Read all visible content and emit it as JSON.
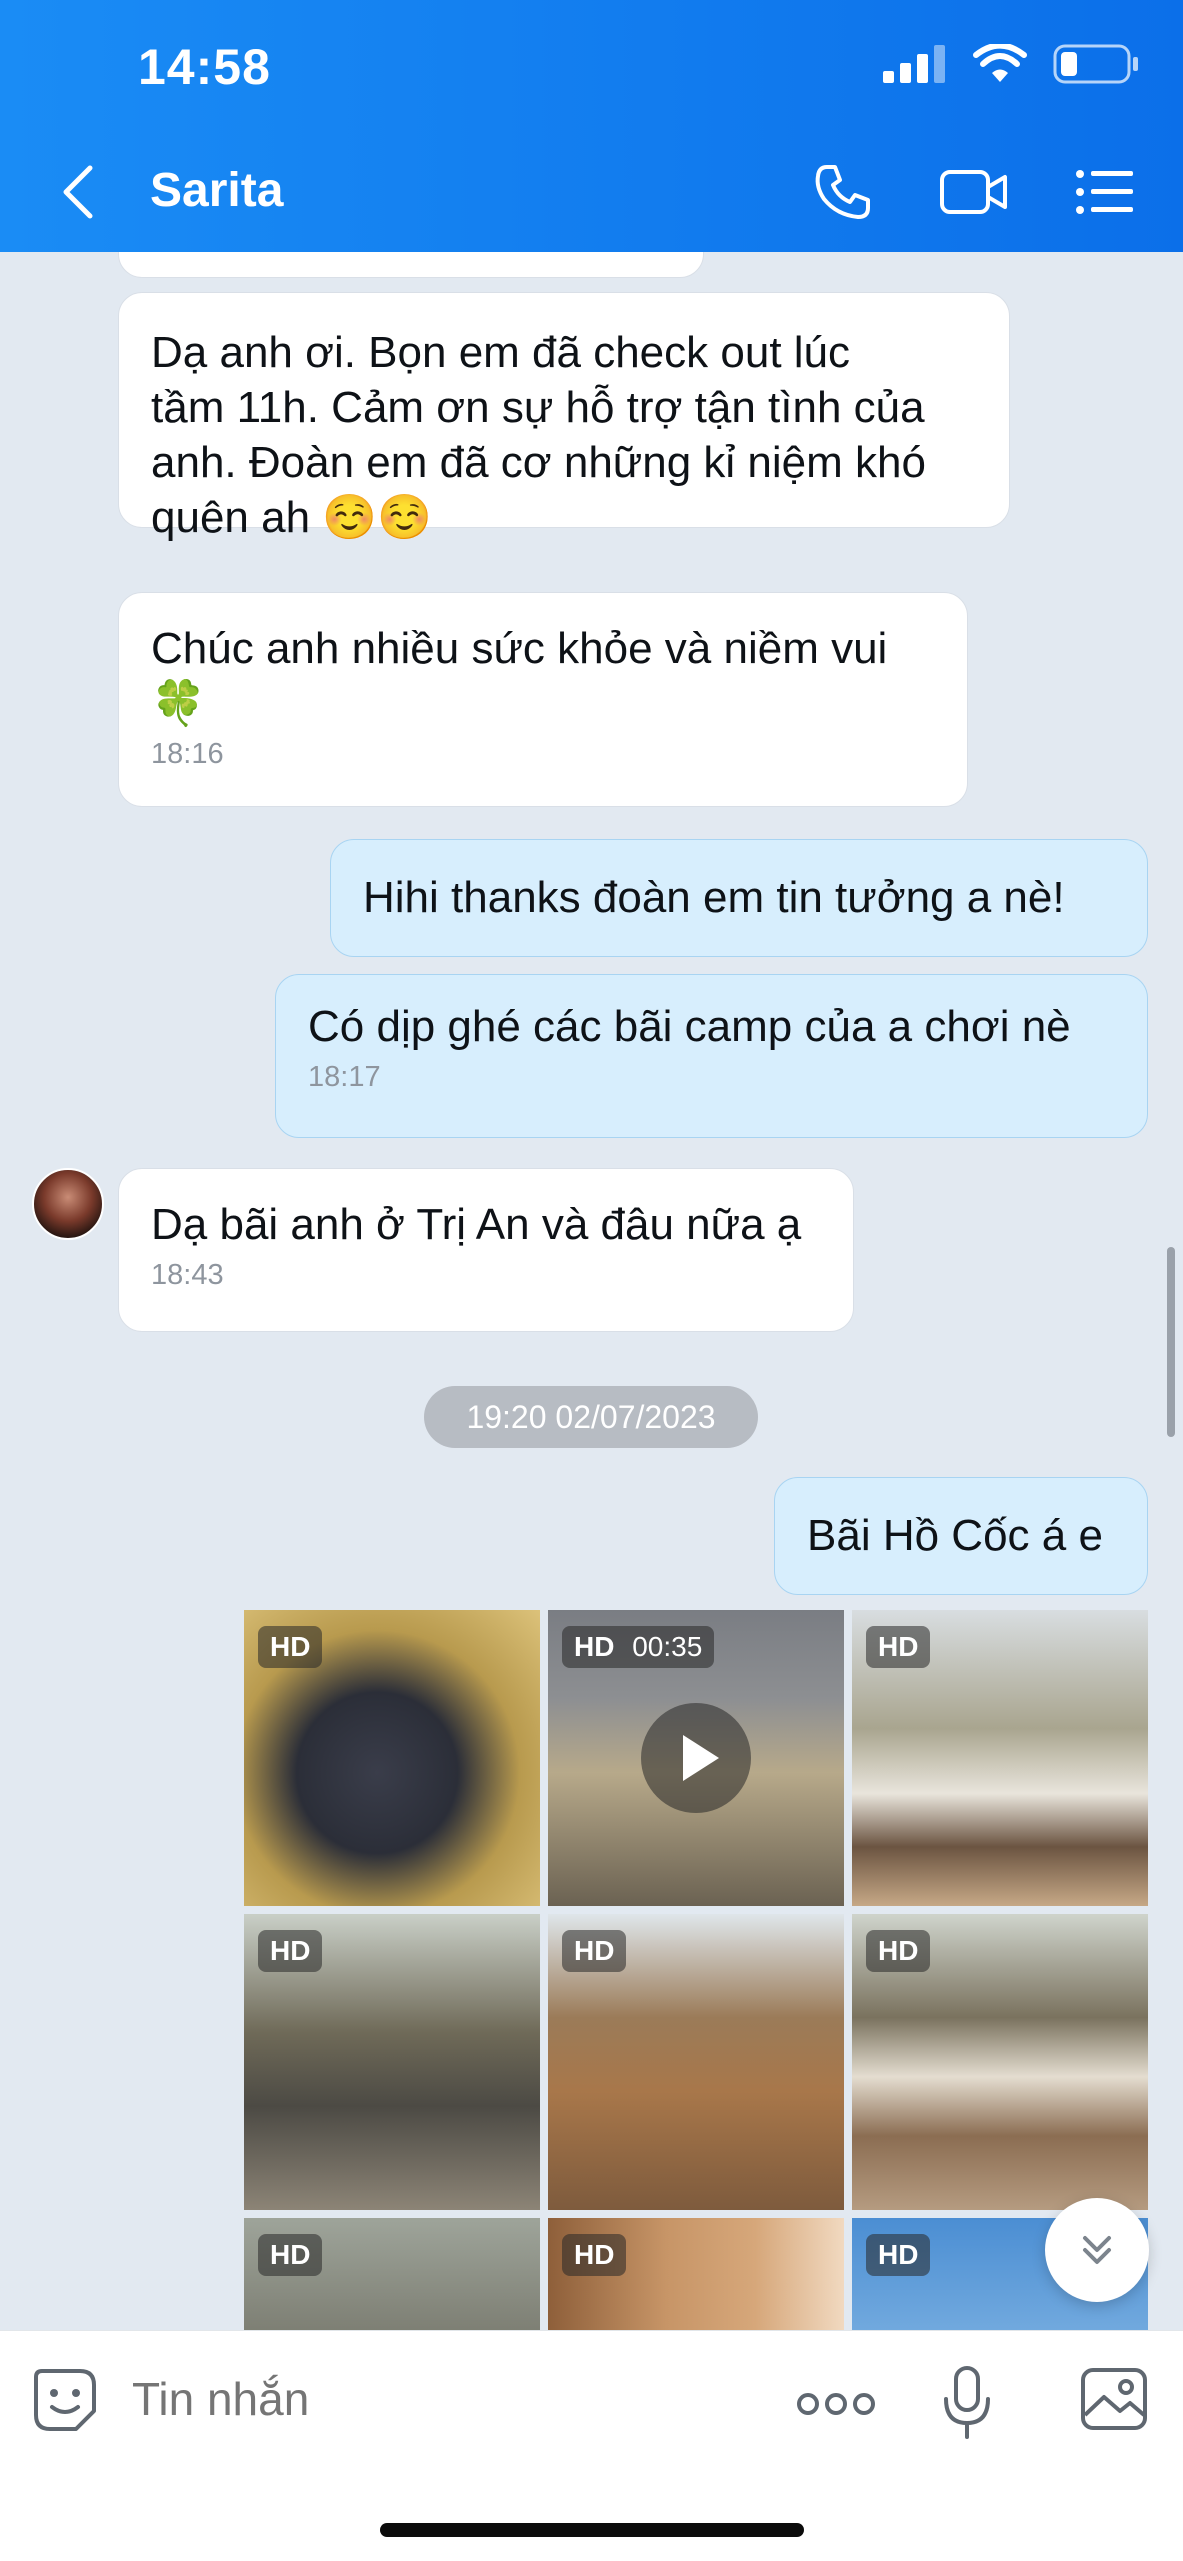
{
  "status_bar": {
    "time": "14:58"
  },
  "header": {
    "contact_name": "Sarita"
  },
  "messages": [
    {
      "text": "Dạ anh ơi. Bọn em đã check out lúc\ntầm 11h. Cảm ơn sự hỗ trợ tận tình của\nanh. Đoàn em đã cơ những kỉ niệm khó\nquên ah ☺️☺️",
      "time": ""
    },
    {
      "text": "Chúc anh nhiều sức khỏe và niềm vui\n🍀",
      "time": "18:16"
    },
    {
      "text": "Hihi thanks đoàn em tin tưởng a nè!",
      "time": ""
    },
    {
      "text": "Có dịp ghé các bãi camp của a chơi nè",
      "time": "18:17"
    },
    {
      "text": "Dạ bãi anh ở Trị An và đâu nữa ạ",
      "time": "18:43"
    },
    {
      "text": "Bãi Hồ Cốc á e",
      "time": ""
    }
  ],
  "date_separator": "19:20 02/07/2023",
  "media": [
    {
      "badge": "HD",
      "duration": ""
    },
    {
      "badge": "HD",
      "duration": "00:35"
    },
    {
      "badge": "HD",
      "duration": ""
    },
    {
      "badge": "HD",
      "duration": ""
    },
    {
      "badge": "HD",
      "duration": ""
    },
    {
      "badge": "HD",
      "duration": ""
    },
    {
      "badge": "HD",
      "duration": ""
    },
    {
      "badge": "HD",
      "duration": ""
    },
    {
      "badge": "HD",
      "duration": ""
    }
  ],
  "input": {
    "placeholder": "Tin nhắn"
  },
  "colors": {
    "header": "#1a8cf5",
    "incoming_bubble": "#ffffff",
    "outgoing_bubble": "#d7eefd",
    "background": "#e2e9f1"
  }
}
